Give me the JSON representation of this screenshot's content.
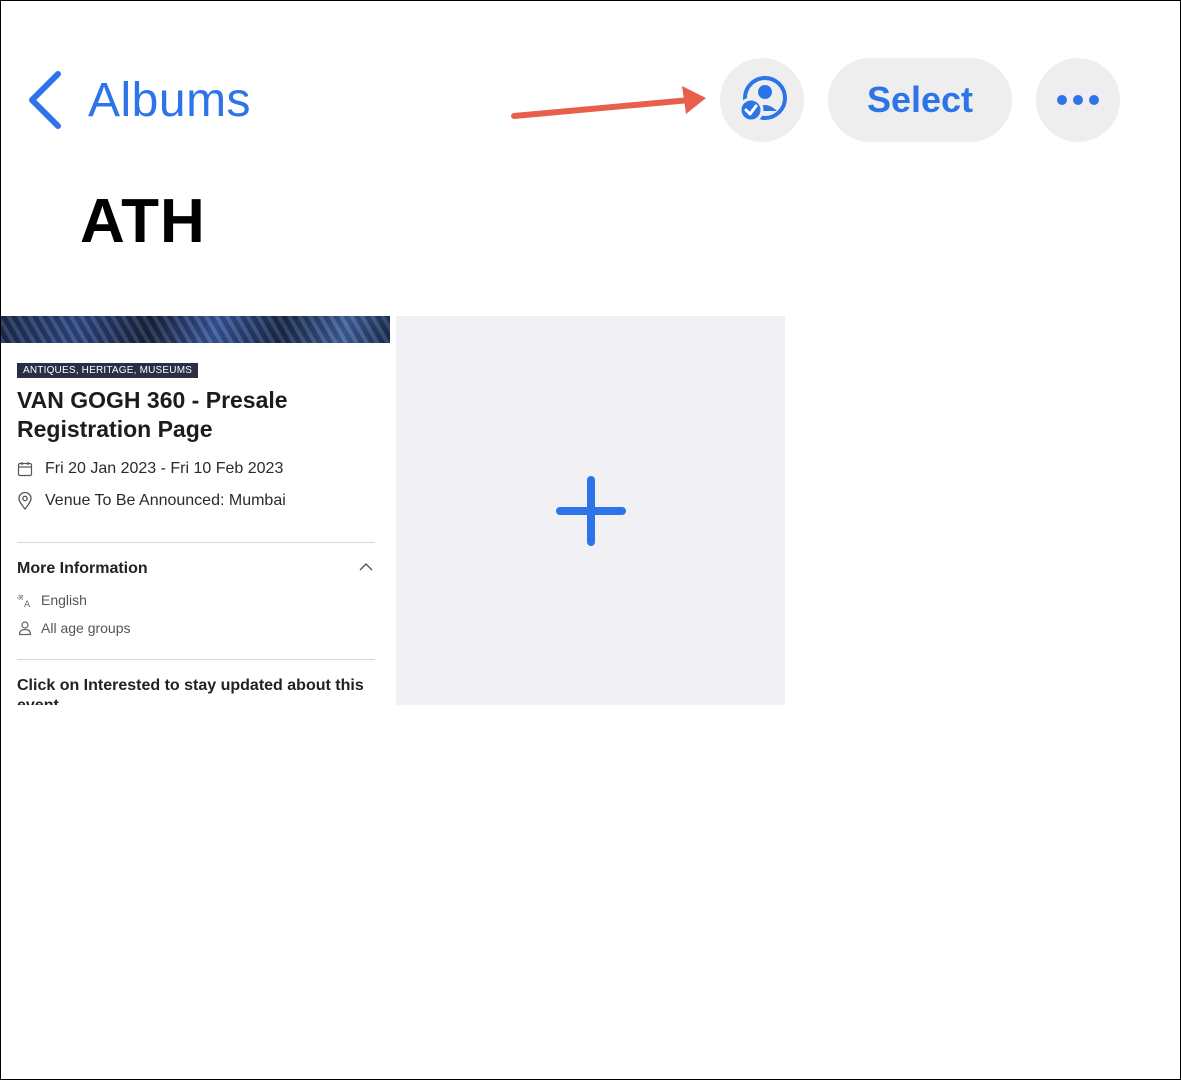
{
  "nav": {
    "back_label": "Albums",
    "back_icon": "chevron-left-icon",
    "shared_icon": "person-checkmark-icon",
    "select_label": "Select",
    "more_icon": "ellipsis-icon"
  },
  "album": {
    "title": "ATH"
  },
  "photo": {
    "tag": "ANTIQUES, HERITAGE, MUSEUMS",
    "event_title": "VAN GOGH 360 - Presale Registration Page",
    "date": "Fri 20 Jan 2023 - Fri 10 Feb 2023",
    "venue": "Venue To Be Announced: Mumbai",
    "more_info": "More Information",
    "language": "English",
    "age": "All age groups",
    "footer_text": "Click on Interested to stay updated about this event"
  },
  "add_tile": {
    "icon": "plus-icon"
  },
  "colors": {
    "accent": "#2d74e8",
    "button_bg": "#eeeeef",
    "annotation_arrow": "#e8604c",
    "tile_bg": "#f1f1f5"
  }
}
